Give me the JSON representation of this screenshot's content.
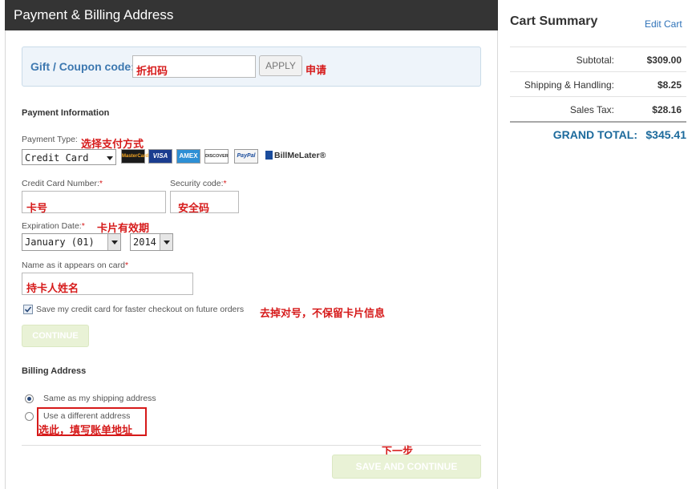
{
  "header": {
    "title": "Payment & Billing Address"
  },
  "coupon": {
    "label": "Gift / Coupon code:",
    "input_value": "折扣码",
    "apply_label": "APPLY",
    "apply_note": "申请"
  },
  "payment": {
    "section_title": "Payment Information",
    "type_label": "Payment Type:",
    "type_note": "选择支付方式",
    "type_value": "Credit Card",
    "card_logos": [
      "MasterCard",
      "VISA",
      "AMEX",
      "DISCOVER",
      "PayPal",
      "BillMeLater®"
    ],
    "cc_number_label": "Credit Card Number:",
    "cc_number_value": "卡号",
    "security_label": "Security code:",
    "security_value": "安全码",
    "required_mark": "*",
    "expiration_label": "Expiration Date:",
    "expiration_note": "卡片有效期",
    "exp_month_value": "January (01)",
    "exp_year_value": "2014",
    "name_label": "Name as it appears on card",
    "name_value": "持卡人姓名",
    "save_card_label": "Save my credit card for faster checkout on future orders",
    "save_card_checked": true,
    "save_card_note": "去掉对号，不保留卡片信息",
    "continue_label": "CONTINUE"
  },
  "billing": {
    "section_title": "Billing Address",
    "same_label": "Same as my shipping address",
    "different_label": "Use a different address",
    "different_note": "选此，填写账单地址",
    "next_note": "下一步",
    "save_continue_label": "SAVE AND CONTINUE"
  },
  "cart": {
    "title": "Cart Summary",
    "edit_label": "Edit Cart",
    "rows": [
      {
        "label": "Subtotal:",
        "value": "$309.00"
      },
      {
        "label": "Shipping & Handling:",
        "value": "$8.25"
      },
      {
        "label": "Sales Tax:",
        "value": "$28.16"
      }
    ],
    "grand_total_label": "GRAND TOTAL:",
    "grand_total_value": "$345.41"
  },
  "colors": {
    "accent_blue": "#3d78b0",
    "annotation_red": "#d61a1a",
    "header_bg": "#343434",
    "disabled_green": "#e9f2d6",
    "grand_total": "#1c6a9c"
  }
}
